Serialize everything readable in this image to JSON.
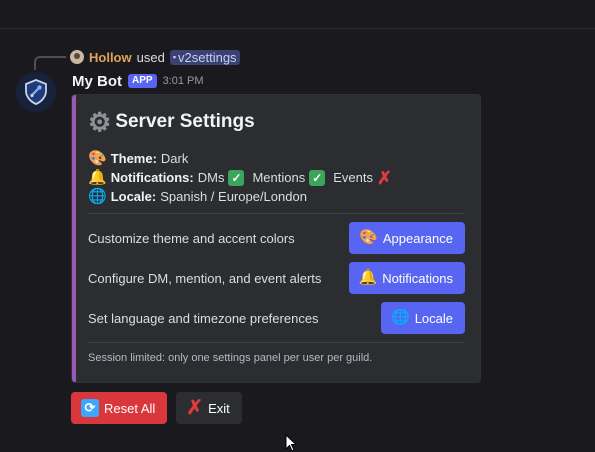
{
  "reply": {
    "username": "Hollow",
    "used_text": "used",
    "command": "v2settings"
  },
  "message": {
    "bot_name": "My Bot",
    "badge": "APP",
    "timestamp": "3:01 PM"
  },
  "embed": {
    "accent_color": "#9b59b6",
    "title": "Server Settings",
    "theme": {
      "label": "Theme:",
      "value": "Dark"
    },
    "notifications": {
      "label": "Notifications:",
      "items": [
        {
          "name": "DMs",
          "enabled": true
        },
        {
          "name": "Mentions",
          "enabled": true
        },
        {
          "name": "Events",
          "enabled": false
        }
      ]
    },
    "locale": {
      "label": "Locale:",
      "value": "Spanish / Europe/London"
    },
    "sections": [
      {
        "text": "Customize theme and accent colors",
        "button": "Appearance",
        "icon": "palette-icon"
      },
      {
        "text": "Configure DM, mention, and event alerts",
        "button": "Notifications",
        "icon": "bell-icon"
      },
      {
        "text": "Set language and timezone preferences",
        "button": "Locale",
        "icon": "globe-icon"
      }
    ],
    "footer": "Session limited: only one settings panel per user per guild."
  },
  "actions": {
    "reset_label": "Reset All",
    "exit_label": "Exit"
  },
  "colors": {
    "background": "#1a1a1e",
    "embed_bg": "#2b2d31",
    "blurple": "#5865f2",
    "danger": "#da373c"
  }
}
